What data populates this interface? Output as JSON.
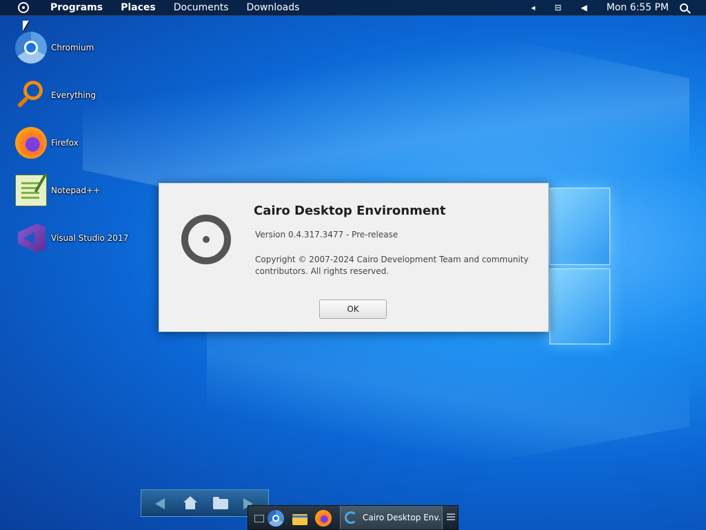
{
  "menubar": {
    "items": [
      {
        "label": "Programs",
        "bold": true
      },
      {
        "label": "Places",
        "bold": true
      },
      {
        "label": "Documents",
        "bold": false
      },
      {
        "label": "Downloads",
        "bold": false
      }
    ],
    "clock": "Mon 6:55 PM",
    "tray_icons": [
      "tray-expand-arrow-icon",
      "network-icon",
      "volume-icon"
    ]
  },
  "desktop": {
    "icons": [
      {
        "label": "Chromium",
        "icon": "chromium-icon"
      },
      {
        "label": "Everything",
        "icon": "everything-search-icon"
      },
      {
        "label": "Firefox",
        "icon": "firefox-icon"
      },
      {
        "label": "Notepad++",
        "icon": "notepad-plus-plus-icon"
      },
      {
        "label": "Visual Studio 2017",
        "icon": "visual-studio-icon"
      }
    ]
  },
  "dialog": {
    "title": "Cairo Desktop Environment",
    "version": "Version 0.4.317.3477 - Pre-release",
    "copyright": "Copyright © 2007-2024 Cairo Development Team and community contributors.  All rights reserved.",
    "ok_label": "OK"
  },
  "taskbar": {
    "active_window": "Cairo Desktop Env...",
    "pinned": [
      "show-desktop-icon",
      "chrome-icon",
      "file-explorer-icon",
      "firefox-icon"
    ]
  },
  "colors": {
    "desktop_bg": "#0b66d4",
    "menubar_bg": "#08142c",
    "dialog_bg": "#f0f0f0"
  }
}
